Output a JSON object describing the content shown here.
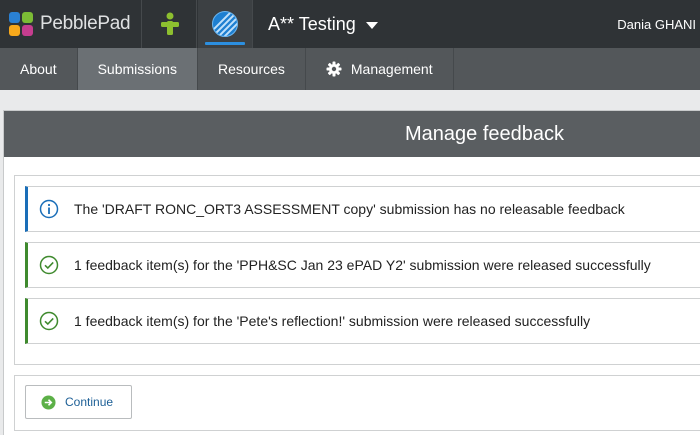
{
  "app": {
    "brand": "PebblePad",
    "workspace_title": "A** Testing",
    "user_name": "Dania GHANI"
  },
  "colors": {
    "logo": [
      "#2a80d2",
      "#7cbc35",
      "#f7a81b",
      "#c63d8f"
    ],
    "accent": "#2c8fe0",
    "person_icon": "#8dbf2f",
    "info": "#1a6eb8",
    "success": "#3f8a2e"
  },
  "nav": {
    "items": [
      {
        "label": "About"
      },
      {
        "label": "Submissions",
        "active": true
      },
      {
        "label": "Resources"
      },
      {
        "label": "Management",
        "icon": "gear-icon"
      }
    ]
  },
  "panel": {
    "title": "Manage feedback"
  },
  "messages": [
    {
      "type": "info",
      "icon": "info-circle-icon",
      "text": "The 'DRAFT RONC_ORT3 ASSESSMENT copy' submission has no releasable feedback"
    },
    {
      "type": "success",
      "icon": "check-circle-icon",
      "text": "1 feedback item(s) for the 'PPH&SC Jan 23 ePAD Y2' submission were released successfully"
    },
    {
      "type": "success",
      "icon": "check-circle-icon",
      "text": "1 feedback item(s) for the 'Pete's reflection!' submission were released successfully"
    }
  ],
  "actions": {
    "continue_label": "Continue",
    "continue_icon": "arrow-right-circle-icon"
  }
}
